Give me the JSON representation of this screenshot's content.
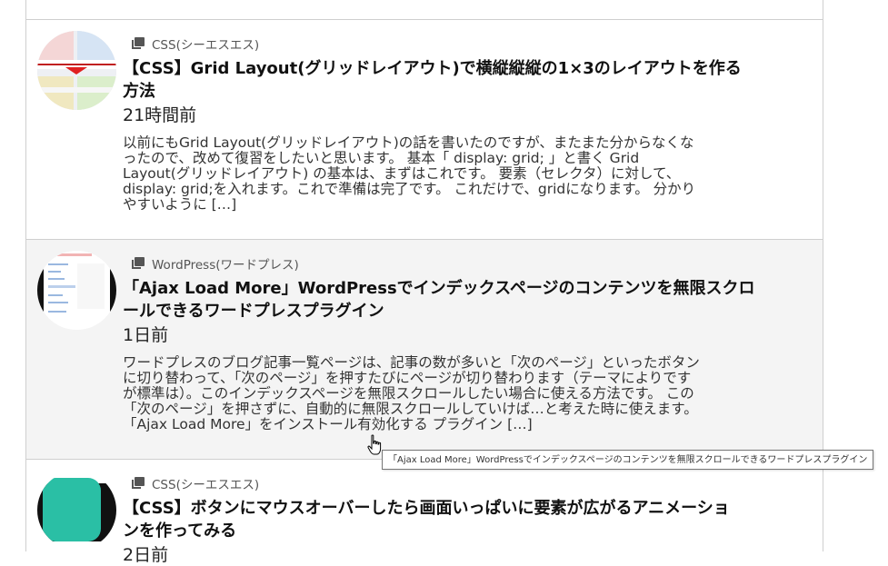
{
  "posts": [
    {
      "category": "CSS(シーエスエス)",
      "title_line1": "【CSS】Grid Layout(グリッドレイアウト)で横縦縦縦の1×3のレイアウトを作る",
      "title_line2": "方法",
      "date": "21時間前",
      "excerpt": [
        "以前にもGrid Layout(グリッドレイアウト)の話を書いたのですが、またまた分からなくな",
        "ったので、改めて復習をしたいと思います。 基本「 display: grid; 」と書く Grid",
        "Layout(グリッドレイアウト) の基本は、まずはこれです。 要素（セレクタ）に対して、",
        "display: grid;を入れます。これで準備は完了です。 これだけで、gridになります。 分かり",
        "やすいように […]"
      ]
    },
    {
      "category": "WordPress(ワードプレス)",
      "title_line1": "「Ajax Load More」WordPressでインデックスページのコンテンツを無限スクロ",
      "title_line2": "ールできるワードプレスプラグイン",
      "date": "1日前",
      "excerpt": [
        "ワードプレスのブログ記事一覧ページは、記事の数が多いと「次のページ」といったボタン",
        "に切り替わって、「次のページ」を押すたびにページが切り替わります（テーマによりです",
        "が標準は）。このインデックスページを無限スクロールしたい場合に使える方法です。 この",
        "「次のページ」を押さずに、自動的に無限スクロールしていけば…と考えた時に使えます。",
        "「Ajax Load More」をインストール有効化する プラグイン […]"
      ]
    },
    {
      "category": "CSS(シーエスエス)",
      "title_line1": "【CSS】ボタンにマウスオーバーしたら画面いっぱいに要素が広がるアニメーショ",
      "title_line2": "ンを作ってみる",
      "date": "2日前"
    }
  ],
  "tooltip": "「Ajax Load More」WordPressでインデックスページのコンテンツを無限スクロールできるワードプレスプラグイン",
  "colors": {
    "teal": "#2abfa5",
    "red": "#e02020",
    "border": "#cfcfcf",
    "hover_bg": "#f4f4f4"
  },
  "icons": {
    "category": "category-folder-icon",
    "cursor": "hand-pointer-icon"
  }
}
